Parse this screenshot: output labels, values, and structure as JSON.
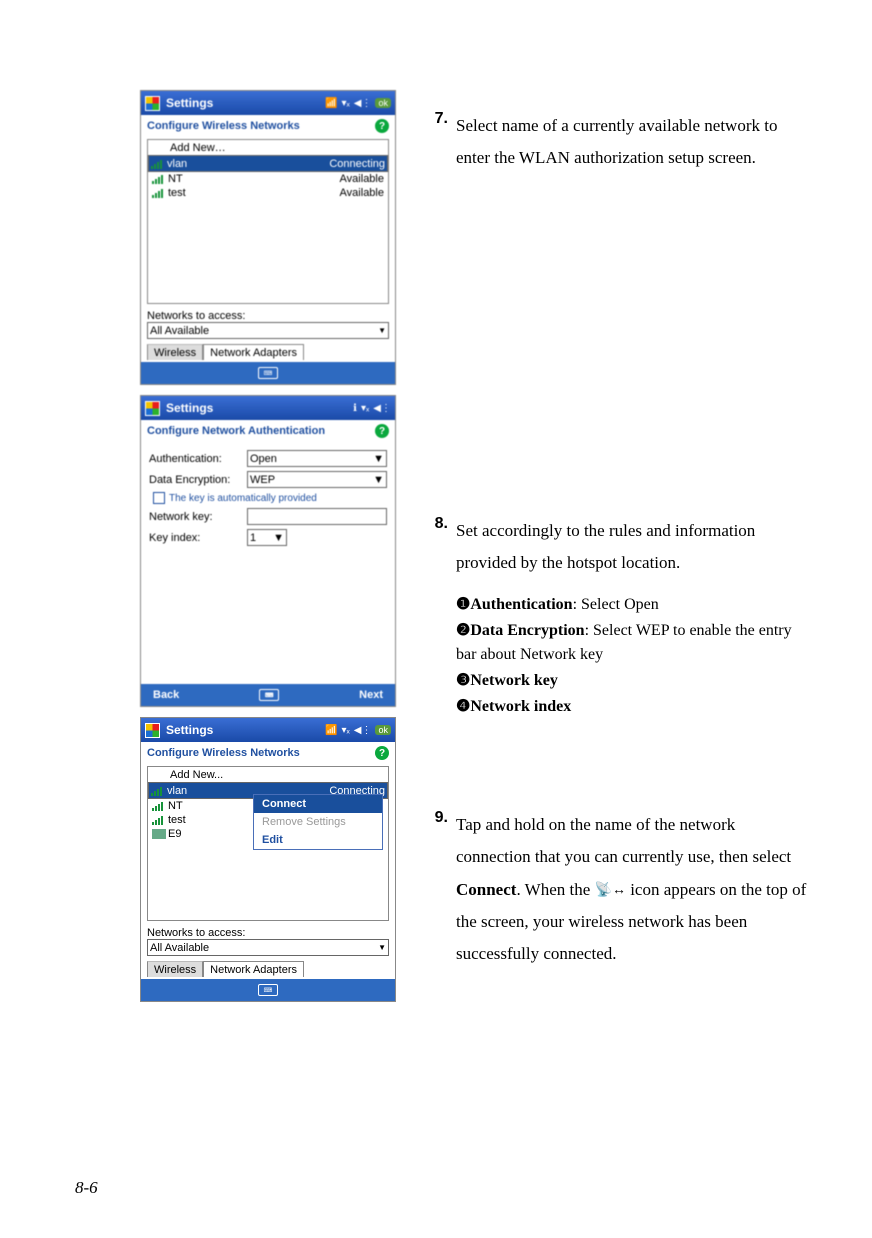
{
  "page_number": "8-6",
  "step7": {
    "num": "7.",
    "text": "Select name of a currently available network to enter the WLAN authorization setup screen."
  },
  "step8": {
    "num": "8.",
    "text": "Set accordingly to the rules and information provided by the hotspot location.",
    "b1_n": "❶",
    "b1_label": "Authentication",
    "b1_rest": ": Select Open",
    "b2_n": "❷",
    "b2_label": "Data Encryption",
    "b2_rest": ": Select WEP to enable the entry bar about Network key",
    "b3_n": "❸",
    "b3_label": "Network key",
    "b4_n": "❹",
    "b4_label": "Network index"
  },
  "step9": {
    "num": "9.",
    "text_a": "Tap and hold on the name of the network connection that you can currently use, then select ",
    "text_b": "Connect",
    "text_c": ". When the ",
    "text_d": " icon appears on the top of the screen, your wireless network has been successfully connected."
  },
  "icons": {
    "connected_icon_alt": "antenna-icon"
  },
  "screen1": {
    "title": "Settings",
    "ok": "ok",
    "subheader": "Configure Wireless Networks",
    "add_new": "Add New…",
    "nets": [
      {
        "name": "vlan",
        "status": "Connecting",
        "selected": true
      },
      {
        "name": "NT",
        "status": "Available",
        "selected": false
      },
      {
        "name": "test",
        "status": "Available",
        "selected": false
      }
    ],
    "access_label": "Networks to access:",
    "access_value": "All Available",
    "tab1": "Wireless",
    "tab2": "Network Adapters"
  },
  "screen2": {
    "title": "Settings",
    "subheader": "Configure Network Authentication",
    "auth_label": "Authentication:",
    "auth_value": "Open",
    "enc_label": "Data Encryption:",
    "enc_value": "WEP",
    "chk_label": "The key is automatically provided",
    "netkey_label": "Network key:",
    "idx_label": "Key index:",
    "idx_value": "1",
    "back": "Back",
    "next": "Next"
  },
  "screen3": {
    "title": "Settings",
    "ok": "ok",
    "subheader": "Configure Wireless Networks",
    "add_new": "Add New...",
    "nets": [
      {
        "name": "vlan",
        "status": "Connecting",
        "selected": true
      },
      {
        "name": "NT",
        "status": "",
        "selected": false
      },
      {
        "name": "test",
        "status": "",
        "selected": false
      },
      {
        "name": "E9",
        "status": "",
        "selected": false
      }
    ],
    "ctx": {
      "connect": "Connect",
      "remove": "Remove Settings",
      "edit": "Edit"
    },
    "access_label": "Networks to access:",
    "access_value": "All Available",
    "tab1": "Wireless",
    "tab2": "Network Adapters"
  }
}
